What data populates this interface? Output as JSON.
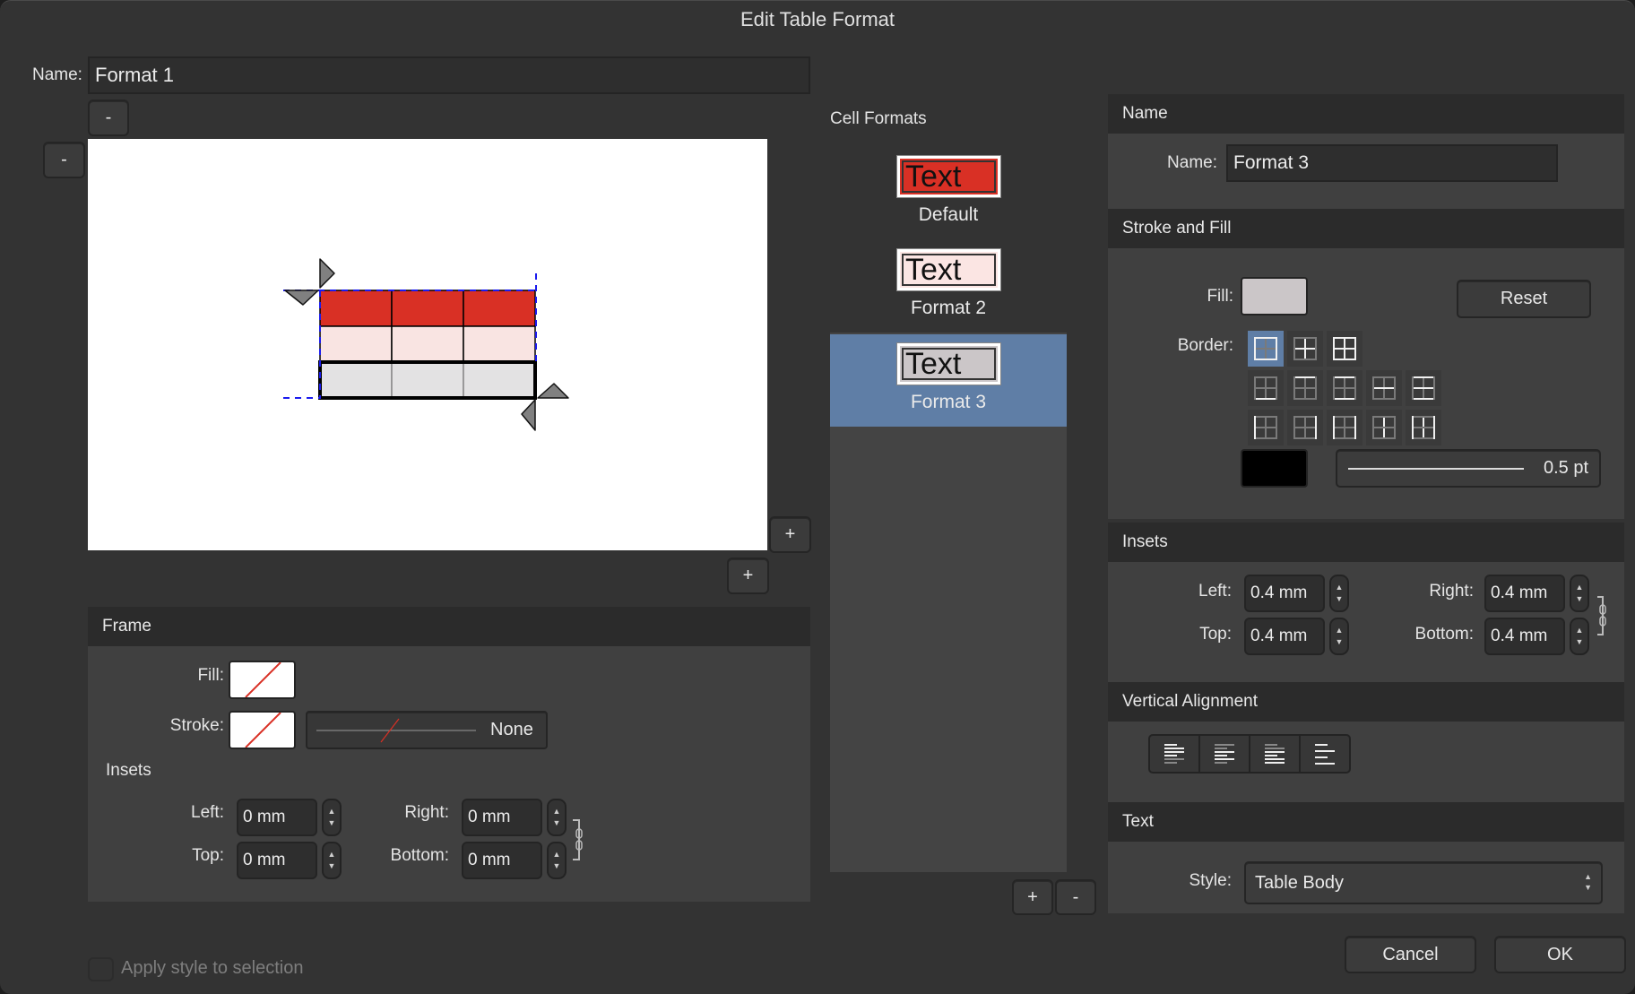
{
  "dialog": {
    "title": "Edit Table Format",
    "name_label": "Name:",
    "name_value": "Format 1",
    "remove_column_label": "-",
    "remove_row_label": "-",
    "add_column_label": "+",
    "add_row_label": "+",
    "apply_checkbox_label": "Apply style to selection",
    "apply_checked": false,
    "cancel_label": "Cancel",
    "ok_label": "OK"
  },
  "preview": {
    "rows": [
      {
        "format": "Default",
        "fill": "#d93025"
      },
      {
        "format": "Format 2",
        "fill": "#f9e4e2"
      },
      {
        "format": "Format 3",
        "fill": "#e3e2e3"
      }
    ],
    "columns": 3,
    "guide_color": "#1a1aee",
    "handle_color": "#808080"
  },
  "frame": {
    "header": "Frame",
    "fill_label": "Fill:",
    "fill_value": "none",
    "stroke_label": "Stroke:",
    "stroke_value": "none",
    "stroke_style_label": "None",
    "insets_label": "Insets",
    "left_label": "Left:",
    "left_value": "0 mm",
    "right_label": "Right:",
    "right_value": "0 mm",
    "top_label": "Top:",
    "top_value": "0 mm",
    "bottom_label": "Bottom:",
    "bottom_value": "0 mm"
  },
  "cell_formats": {
    "header": "Cell Formats",
    "items": [
      {
        "label": "Default",
        "thumb_text": "Text",
        "fill": "#d93025",
        "selected": false
      },
      {
        "label": "Format 2",
        "thumb_text": "Text",
        "fill": "#fbe5e3",
        "selected": false
      },
      {
        "label": "Format 3",
        "thumb_text": "Text",
        "fill": "#cbc6c8",
        "selected": true
      }
    ],
    "add_label": "+",
    "remove_label": "-",
    "selected_color": "#5f7ea6"
  },
  "cell_props": {
    "name_section": {
      "header": "Name",
      "name_label": "Name:",
      "name_value": "Format 3"
    },
    "stroke_fill": {
      "header": "Stroke and Fill",
      "fill_label": "Fill:",
      "fill_color": "#cbc6c8",
      "reset_label": "Reset",
      "border_label": "Border:",
      "border_presets": [
        [
          "outer",
          "inner",
          "all"
        ],
        [
          "bottom",
          "top",
          "top-bottom",
          "horizontal-middle",
          "horizontal-all"
        ],
        [
          "left",
          "right",
          "left-right",
          "vertical-middle",
          "vertical-all"
        ]
      ],
      "selected_border": "outer",
      "stroke_color": "#000000",
      "stroke_width": "0.5 pt"
    },
    "insets": {
      "header": "Insets",
      "left_label": "Left:",
      "left_value": "0.4 mm",
      "right_label": "Right:",
      "right_value": "0.4 mm",
      "top_label": "Top:",
      "top_value": "0.4 mm",
      "bottom_label": "Bottom:",
      "bottom_value": "0.4 mm"
    },
    "vertical_alignment": {
      "header": "Vertical Alignment",
      "options": [
        "top",
        "center",
        "bottom",
        "justify"
      ]
    },
    "text": {
      "header": "Text",
      "style_label": "Style:",
      "style_value": "Table Body"
    }
  }
}
